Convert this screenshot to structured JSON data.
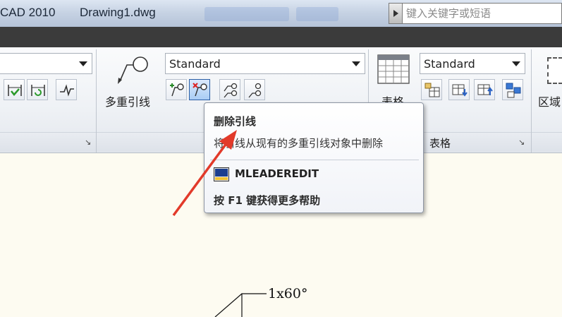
{
  "titlebar": {
    "app_title": "CAD 2010",
    "document_title": "Drawing1.dwg"
  },
  "search": {
    "placeholder": "键入关键字或短语"
  },
  "ribbon": {
    "leader_panel": {
      "big_button_label": "多重引线",
      "style_value": "Standard"
    },
    "table_panel": {
      "big_button_label": "表格",
      "style_value": "Standard",
      "footer_label": "表格"
    },
    "region_panel": {
      "big_button_label": "区域"
    }
  },
  "tooltip": {
    "title": "删除引线",
    "description": "将引线从现有的多重引线对象中删除",
    "command": "MLEADEREDIT",
    "help": "按 F1 键获得更多帮助"
  },
  "drawing": {
    "dimension_text": "1x60°"
  },
  "colors": {
    "annotation_arrow": "#e23a2a",
    "canvas_background": "#fdfbf1"
  }
}
